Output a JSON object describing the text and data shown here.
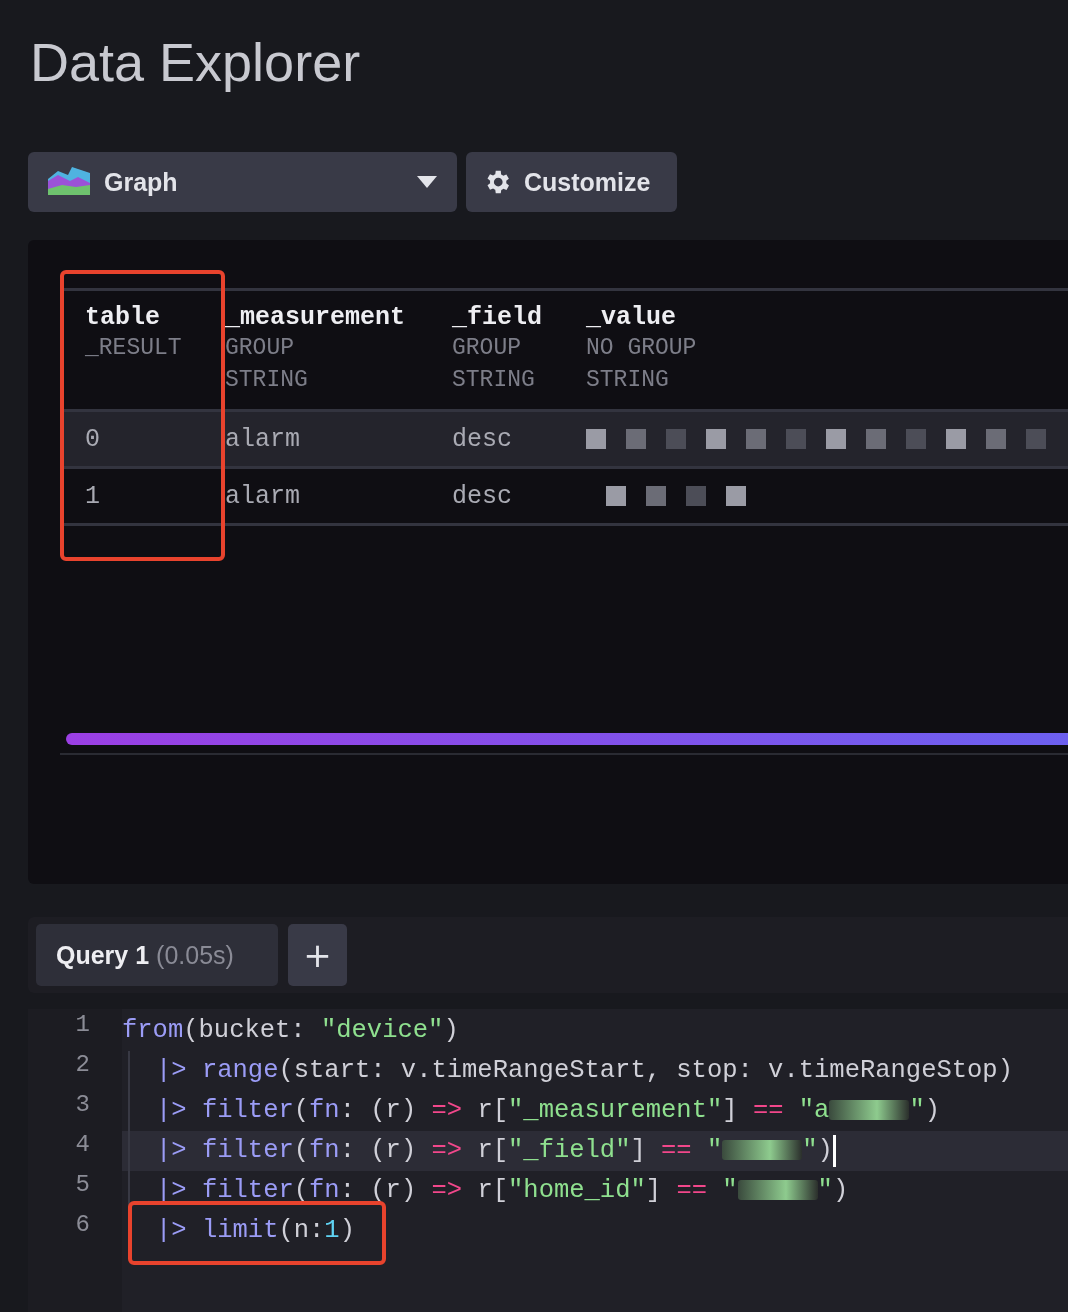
{
  "page_title": "Data Explorer",
  "toolbar": {
    "view_type": {
      "label": "Graph"
    },
    "customize": {
      "label": "Customize"
    }
  },
  "table": {
    "columns": [
      {
        "name": "table",
        "group": "_RESULT",
        "annotated": true
      },
      {
        "name": "_measurement",
        "group": "GROUP",
        "type": "STRING",
        "annotated": false
      },
      {
        "name": "_field",
        "group": "GROUP",
        "type": "STRING",
        "annotated": false
      },
      {
        "name": "_value",
        "group": "NO GROUP",
        "type": "STRING",
        "annotated": false
      }
    ],
    "rows": [
      {
        "selected": true,
        "cells": [
          {
            "kind": "text",
            "text": "0"
          },
          {
            "kind": "text",
            "text": "alarm"
          },
          {
            "kind": "text",
            "text": "desc"
          },
          {
            "kind": "redacted"
          }
        ]
      },
      {
        "selected": false,
        "cells": [
          {
            "kind": "text",
            "text": "1"
          },
          {
            "kind": "text",
            "text": "alarm"
          },
          {
            "kind": "text",
            "text": "desc"
          },
          {
            "kind": "redacted"
          }
        ]
      }
    ]
  },
  "query_tabs": [
    {
      "label": "Query 1",
      "time": "(0.05s)",
      "selected": true
    }
  ],
  "add_query": {
    "label": "+"
  },
  "editor": {
    "lines": [
      {
        "number": "1",
        "continuation": false,
        "active": false,
        "annotated": false,
        "tokens": [
          {
            "kind": "fn",
            "text": "from"
          },
          {
            "kind": "plain",
            "text": "(bucket: "
          },
          {
            "kind": "str",
            "text": "\"device\""
          },
          {
            "kind": "plain",
            "text": ")"
          }
        ]
      },
      {
        "number": "2",
        "continuation": true,
        "active": false,
        "annotated": false,
        "tokens": [
          {
            "kind": "fn",
            "text": "|> "
          },
          {
            "kind": "fn",
            "text": "range"
          },
          {
            "kind": "plain",
            "text": "(start: v.timeRangeStart, stop: v.timeRangeStop)"
          }
        ]
      },
      {
        "number": "3",
        "continuation": true,
        "active": false,
        "annotated": false,
        "tokens": [
          {
            "kind": "fn",
            "text": "|> "
          },
          {
            "kind": "fn",
            "text": "filter"
          },
          {
            "kind": "plain",
            "text": "("
          },
          {
            "kind": "fn",
            "text": "fn"
          },
          {
            "kind": "plain",
            "text": ": (r) "
          },
          {
            "kind": "op",
            "text": "=>"
          },
          {
            "kind": "plain",
            "text": " r["
          },
          {
            "kind": "str",
            "text": "\"_measurement\""
          },
          {
            "kind": "plain",
            "text": "] "
          },
          {
            "kind": "op",
            "text": "=="
          },
          {
            "kind": "str",
            "text": " \"a"
          },
          {
            "kind": "redacted"
          },
          {
            "kind": "str",
            "text": "\""
          },
          {
            "kind": "plain",
            "text": ")"
          }
        ]
      },
      {
        "number": "4",
        "continuation": true,
        "active": true,
        "annotated": false,
        "tokens": [
          {
            "kind": "fn",
            "text": "|> "
          },
          {
            "kind": "fn",
            "text": "filter"
          },
          {
            "kind": "plain",
            "text": "("
          },
          {
            "kind": "fn",
            "text": "fn"
          },
          {
            "kind": "plain",
            "text": ": (r) "
          },
          {
            "kind": "op",
            "text": "=>"
          },
          {
            "kind": "plain",
            "text": " r["
          },
          {
            "kind": "str",
            "text": "\"_field\""
          },
          {
            "kind": "plain",
            "text": "] "
          },
          {
            "kind": "op",
            "text": "=="
          },
          {
            "kind": "str",
            "text": " \""
          },
          {
            "kind": "redacted"
          },
          {
            "kind": "str",
            "text": "\""
          },
          {
            "kind": "plain",
            "text": ")"
          }
        ]
      },
      {
        "number": "5",
        "continuation": true,
        "active": false,
        "annotated": false,
        "tokens": [
          {
            "kind": "fn",
            "text": "|> "
          },
          {
            "kind": "fn",
            "text": "filter"
          },
          {
            "kind": "plain",
            "text": "("
          },
          {
            "kind": "fn",
            "text": "fn"
          },
          {
            "kind": "plain",
            "text": ": (r) "
          },
          {
            "kind": "op",
            "text": "=>"
          },
          {
            "kind": "plain",
            "text": " r["
          },
          {
            "kind": "str",
            "text": "\"home_id\""
          },
          {
            "kind": "plain",
            "text": "] "
          },
          {
            "kind": "op",
            "text": "=="
          },
          {
            "kind": "str",
            "text": " \""
          },
          {
            "kind": "redacted"
          },
          {
            "kind": "str",
            "text": "\""
          },
          {
            "kind": "plain",
            "text": ")"
          }
        ]
      },
      {
        "number": "6",
        "continuation": true,
        "active": false,
        "annotated": true,
        "tokens": [
          {
            "kind": "fn",
            "text": "|> "
          },
          {
            "kind": "fn",
            "text": "limit"
          },
          {
            "kind": "plain",
            "text": "(n:"
          },
          {
            "kind": "num",
            "text": "1"
          },
          {
            "kind": "plain",
            "text": ")"
          }
        ]
      }
    ]
  }
}
